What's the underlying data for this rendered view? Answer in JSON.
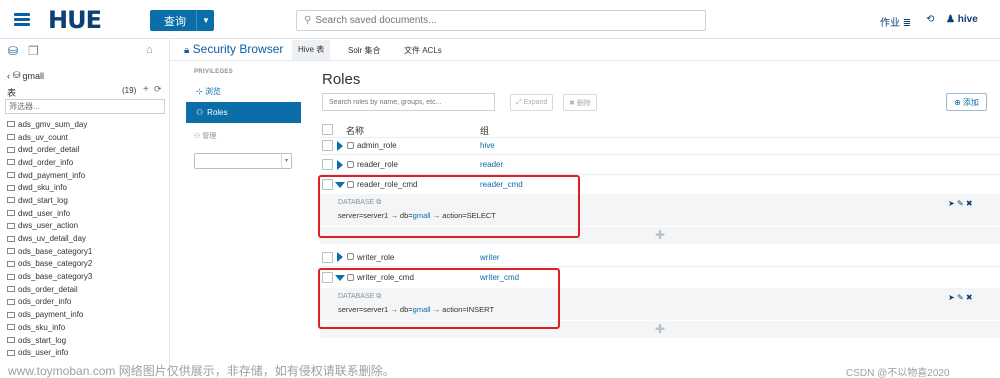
{
  "topbar": {
    "logo": "HUE",
    "query_button": "查询",
    "search_placeholder": "Search saved documents...",
    "jobs": "作业",
    "user": "hive"
  },
  "left": {
    "db_name": "gmall",
    "tables_label": "表",
    "tables_count": "(19)",
    "filter_placeholder": "筛选器...",
    "tables": [
      "ads_gmv_sum_day",
      "ads_uv_count",
      "dwd_order_detail",
      "dwd_order_info",
      "dwd_payment_info",
      "dwd_sku_info",
      "dwd_start_log",
      "dwd_user_info",
      "dws_user_action",
      "dws_uv_detail_day",
      "ods_base_category1",
      "ods_base_category2",
      "ods_base_category3",
      "ods_order_detail",
      "ods_order_info",
      "ods_payment_info",
      "ods_sku_info",
      "ods_start_log",
      "ods_user_info"
    ]
  },
  "header": {
    "section_title": "Security Browser",
    "tabs": [
      "Hive 表",
      "Solr 集合",
      "文件 ACLs"
    ]
  },
  "nav": {
    "privileges_label": "PRIVILEGES",
    "browse_link": "浏览",
    "roles_button": "Roles",
    "admin_label": "管理"
  },
  "main": {
    "title": "Roles",
    "search_placeholder": "Search roles by name, groups, etc...",
    "expand_button": "Expand",
    "delete_button": "删除",
    "add_button": "添加",
    "col_name": "名称",
    "col_group": "组",
    "roles": [
      {
        "name": "admin_role",
        "group": "hive"
      },
      {
        "name": "reader_role",
        "group": "reader"
      },
      {
        "name": "reader_role_cmd",
        "group": "reader_cmd",
        "db_label": "DATABASE",
        "grant": {
          "server": "server=server1",
          "db_prefix": "db=",
          "db": "gmall",
          "action": "action=SELECT"
        }
      },
      {
        "name": "writer_role",
        "group": "writer"
      },
      {
        "name": "writer_role_cmd",
        "group": "writer_cmd",
        "db_label": "DATABASE",
        "grant": {
          "server": "server=server1",
          "db_prefix": "db=",
          "db": "gmall",
          "action": "action=INSERT"
        }
      }
    ],
    "arrow": "→"
  },
  "watermark": "www.toymoban.com 网络图片仅供展示，非存储，如有侵权请联系删除。",
  "csdn": "CSDN @不以物喜2020",
  "colors": {
    "accent": "#0b6ea8",
    "logo": "#0b3f75",
    "highlight_box": "#e02020"
  }
}
